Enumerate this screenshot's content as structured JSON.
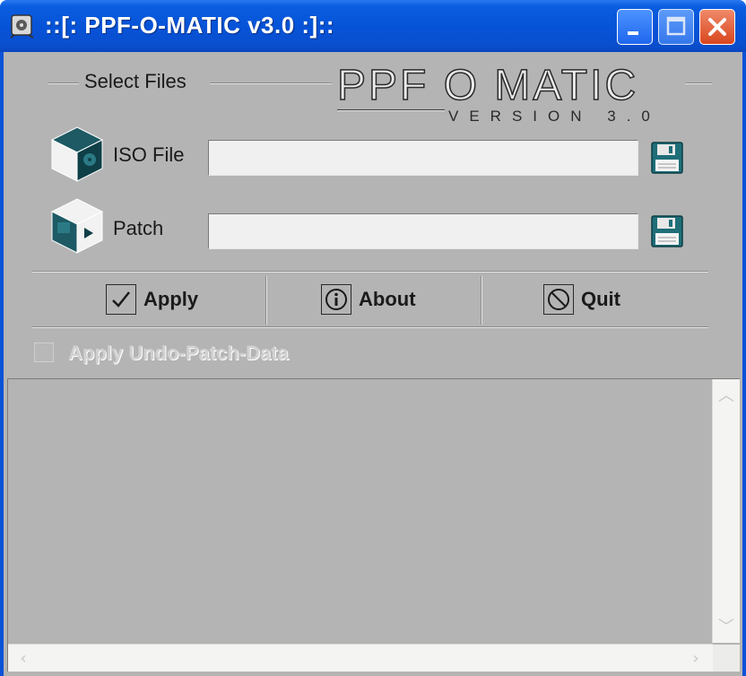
{
  "window": {
    "title": "::[: PPF-O-MATIC v3.0 :]::"
  },
  "select_files": {
    "section_title": "Select Files",
    "logo_main": "PPF O MATIC",
    "logo_sub": "VERSION 3.0"
  },
  "fields": [
    {
      "label": "ISO File",
      "value": "",
      "icon": "iso-cube-icon",
      "browse_icon": "floppy-disk-icon"
    },
    {
      "label": "Patch",
      "value": "",
      "icon": "patch-cube-icon",
      "browse_icon": "floppy-disk-icon"
    }
  ],
  "buttons": {
    "apply": "Apply",
    "about": "About",
    "quit": "Quit"
  },
  "options": {
    "undo_patch_label": "Apply Undo-Patch-Data",
    "undo_patch_checked": false,
    "undo_patch_enabled": false
  },
  "scrollbar_glyphs": {
    "up": "︿",
    "down": "﹀",
    "left": "‹",
    "right": "›"
  },
  "colors": {
    "titlebar": "#0653d8",
    "client_bg": "#b4b4b4",
    "close_button": "#d8461e"
  }
}
